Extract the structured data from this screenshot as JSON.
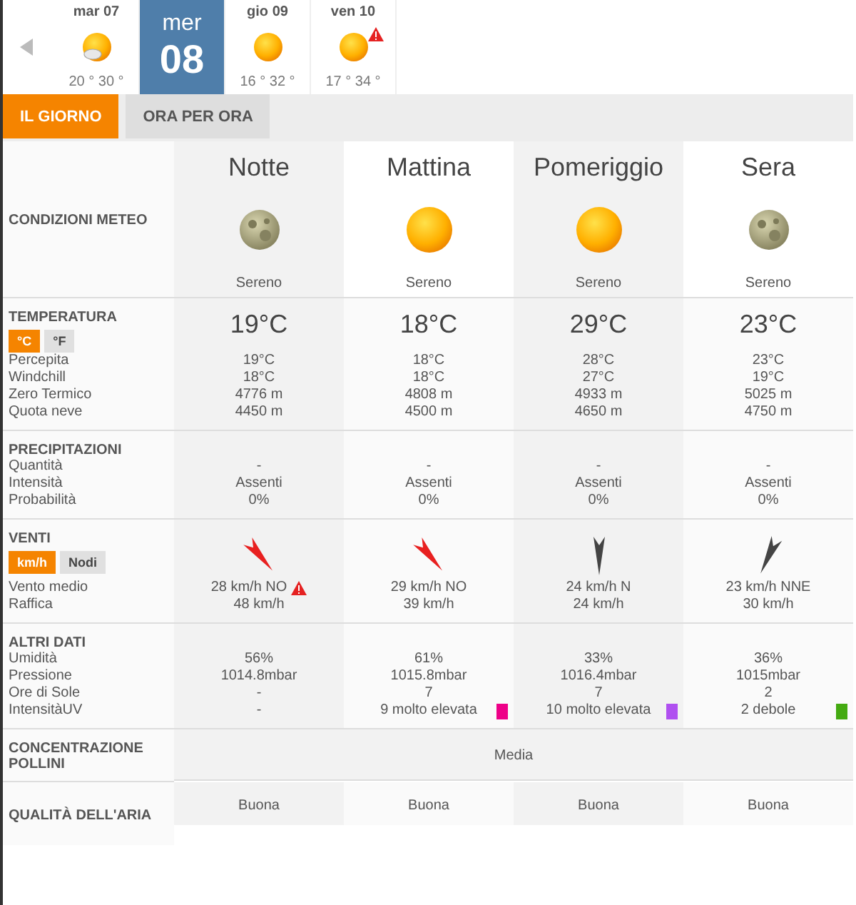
{
  "days": [
    {
      "weekday": "mar 07",
      "kind": "sun-cloud",
      "temps": "20 ° 30 °",
      "warning": false,
      "selected": false
    },
    {
      "weekday": "mer",
      "day": "08",
      "selected": true
    },
    {
      "weekday": "gio 09",
      "kind": "sun",
      "temps": "16 ° 32 °",
      "warning": false,
      "selected": false
    },
    {
      "weekday": "ven 10",
      "kind": "sun",
      "temps": "17 ° 34 °",
      "warning": true,
      "selected": false
    }
  ],
  "tabs": [
    {
      "label": "IL GIORNO",
      "selected": true
    },
    {
      "label": "ORA PER ORA",
      "selected": false
    }
  ],
  "conditions": {
    "title": "CONDIZIONI METEO",
    "periods": [
      {
        "name": "Notte",
        "kind": "moon",
        "condition": "Sereno"
      },
      {
        "name": "Mattina",
        "kind": "sun",
        "condition": "Sereno"
      },
      {
        "name": "Pomeriggio",
        "kind": "sun",
        "condition": "Sereno"
      },
      {
        "name": "Sera",
        "kind": "moon",
        "condition": "Sereno"
      }
    ]
  },
  "temperature": {
    "title": "TEMPERATURA",
    "units": [
      {
        "label": "°C",
        "selected": true
      },
      {
        "label": "°F",
        "selected": false
      }
    ],
    "labels": [
      "Percepita",
      "Windchill",
      "Zero Termico",
      "Quota neve"
    ],
    "columns": [
      {
        "value": "19°C",
        "details": [
          "19°C",
          "18°C",
          "4776 m",
          "4450 m"
        ]
      },
      {
        "value": "18°C",
        "details": [
          "18°C",
          "18°C",
          "4808 m",
          "4500 m"
        ]
      },
      {
        "value": "29°C",
        "details": [
          "28°C",
          "27°C",
          "4933 m",
          "4650 m"
        ]
      },
      {
        "value": "23°C",
        "details": [
          "23°C",
          "19°C",
          "5025 m",
          "4750 m"
        ]
      }
    ]
  },
  "precipitation": {
    "title": "PRECIPITAZIONI",
    "labels": [
      "Quantità",
      "Intensità",
      "Probabilità"
    ],
    "columns": [
      [
        "-",
        "Assenti",
        "0%"
      ],
      [
        "-",
        "Assenti",
        "0%"
      ],
      [
        "-",
        "Assenti",
        "0%"
      ],
      [
        "-",
        "Assenti",
        "0%"
      ]
    ]
  },
  "wind": {
    "title": "VENTI",
    "units": [
      {
        "label": "km/h",
        "selected": true
      },
      {
        "label": "Nodi",
        "selected": false
      }
    ],
    "labels": [
      "Vento medio",
      "Raffica"
    ],
    "columns": [
      {
        "kind": "nw",
        "strong": true,
        "speed": "28 km/h  NO",
        "warning": true,
        "gust": "48 km/h"
      },
      {
        "kind": "nw",
        "strong": true,
        "speed": "29 km/h NO",
        "warning": false,
        "gust": "39 km/h"
      },
      {
        "kind": "n",
        "strong": false,
        "speed": "24 km/h N",
        "warning": false,
        "gust": "24 km/h"
      },
      {
        "kind": "nne",
        "strong": false,
        "speed": "23 km/h NNE",
        "warning": false,
        "gust": "30 km/h"
      }
    ]
  },
  "other": {
    "title": "ALTRI DATI",
    "labels": [
      "Umidità",
      "Pressione",
      "Ore di Sole",
      "IntensitàUV"
    ],
    "columns": [
      {
        "values": [
          "56%",
          "1014.8mbar",
          "-",
          "-"
        ]
      },
      {
        "values": [
          "61%",
          "1015.8mbar",
          "7",
          "9 molto elevata"
        ],
        "color": "#ee0088"
      },
      {
        "values": [
          "33%",
          "1016.4mbar",
          "7",
          "10 molto elevata"
        ],
        "color": "#b050f0"
      },
      {
        "values": [
          "36%",
          "1015mbar",
          "2",
          "2 debole"
        ],
        "color": "#44aa11"
      }
    ]
  },
  "pollen": {
    "title": "CONCENTRAZIONE POLLINI",
    "value": "Media"
  },
  "air": {
    "title": "QUALITÀ DELL'ARIA",
    "values": [
      "Buona",
      "Buona",
      "Buona",
      "Buona"
    ]
  }
}
